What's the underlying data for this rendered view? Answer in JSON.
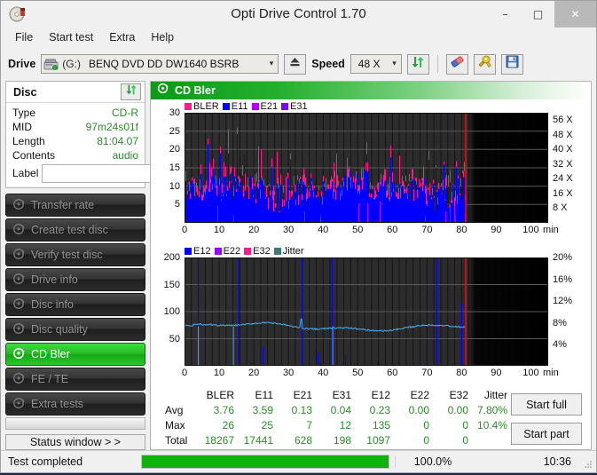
{
  "window": {
    "title": "Opti Drive Control 1.70",
    "icon": "disc-icon",
    "minimize": "–",
    "maximize": "□",
    "close": "✕"
  },
  "menu": {
    "items": [
      "File",
      "Start test",
      "Extra",
      "Help"
    ]
  },
  "toolbar": {
    "drive_label": "Drive",
    "drive_letter": "(G:)",
    "drive_value": "BENQ DVD DD DW1640 BSRB",
    "eject_icon": "eject-icon",
    "speed_label": "Speed",
    "speed_value": "48 X",
    "refresh_icon": "refresh-icon",
    "erase_icon": "eraser-icon",
    "tools_icon": "tools-icon",
    "save_icon": "floppy-save-icon"
  },
  "disc": {
    "header": "Disc",
    "refresh_icon": "refresh-icon",
    "rows": [
      {
        "key": "Type",
        "value": "CD-R"
      },
      {
        "key": "MID",
        "value": "97m24s01f"
      },
      {
        "key": "Length",
        "value": "81:04.07"
      },
      {
        "key": "Contents",
        "value": "audio"
      }
    ],
    "label_key": "Label",
    "label_value": "",
    "label_placeholder": "",
    "disc_icon": "cd-disc-icon"
  },
  "nav": {
    "items": [
      {
        "label": "Transfer rate",
        "icon": "disc-icon",
        "active": false
      },
      {
        "label": "Create test disc",
        "icon": "disc-icon",
        "active": false
      },
      {
        "label": "Verify test disc",
        "icon": "disc-icon",
        "active": false
      },
      {
        "label": "Drive info",
        "icon": "disc-icon",
        "active": false
      },
      {
        "label": "Disc info",
        "icon": "disc-icon",
        "active": false
      },
      {
        "label": "Disc quality",
        "icon": "disc-icon",
        "active": false
      },
      {
        "label": "CD Bler",
        "icon": "disc-icon",
        "active": true
      },
      {
        "label": "FE / TE",
        "icon": "disc-icon",
        "active": false
      },
      {
        "label": "Extra tests",
        "icon": "disc-icon",
        "active": false
      }
    ],
    "status_window": "Status window > >"
  },
  "panel": {
    "title": "CD Bler",
    "icon": "disc-icon"
  },
  "chart_data": [
    {
      "id": "top",
      "type": "bar",
      "title": "",
      "xlabel": "min",
      "ylabel": "",
      "xlim": [
        0,
        105
      ],
      "ylim": [
        0,
        30
      ],
      "xticks": [
        0,
        10,
        20,
        30,
        40,
        50,
        60,
        70,
        80,
        90,
        100
      ],
      "xticklabels": [
        "0",
        "10",
        "20",
        "30",
        "40",
        "50",
        "60",
        "70",
        "80",
        "90",
        "100"
      ],
      "yticks": [
        5,
        10,
        15,
        20,
        25,
        30
      ],
      "yticklabels": [
        "5",
        "10",
        "15",
        "20",
        "25",
        "30"
      ],
      "y2ticks": [
        8,
        16,
        24,
        32,
        40,
        48,
        56
      ],
      "y2ticklabels": [
        "8 X",
        "16 X",
        "24 X",
        "32 X",
        "40 X",
        "48 X",
        "56 X"
      ],
      "y2lim": [
        0,
        60
      ],
      "grid": true,
      "data_end_min": 81.2,
      "legend": [
        {
          "name": "BLER",
          "color": "#ff1a8c"
        },
        {
          "name": "E11",
          "color": "#0000ff"
        },
        {
          "name": "E21",
          "color": "#b400ff"
        },
        {
          "name": "E31",
          "color": "#8000ff"
        }
      ],
      "series": [
        {
          "name": "BLER",
          "color": "#ff1a8c",
          "avg": 3.76,
          "max": 26,
          "total": 18267
        },
        {
          "name": "E11",
          "color": "#0000ff",
          "avg": 3.59,
          "max": 25,
          "total": 17441
        },
        {
          "name": "E21",
          "color": "#b400ff",
          "avg": 0.13,
          "max": 7,
          "total": 628
        },
        {
          "name": "E31",
          "color": "#8000ff",
          "avg": 0.04,
          "max": 12,
          "total": 198
        }
      ],
      "speed_marker_min": 81.2,
      "speed_marker_color": "#ff0000"
    },
    {
      "id": "bottom",
      "type": "line",
      "title": "",
      "xlabel": "min",
      "ylabel": "",
      "xlim": [
        0,
        105
      ],
      "ylim": [
        0,
        200
      ],
      "xticks": [
        0,
        10,
        20,
        30,
        40,
        50,
        60,
        70,
        80,
        90,
        100
      ],
      "xticklabels": [
        "0",
        "10",
        "20",
        "30",
        "40",
        "50",
        "60",
        "70",
        "80",
        "90",
        "100"
      ],
      "yticks": [
        50,
        100,
        150,
        200
      ],
      "yticklabels": [
        "50",
        "100",
        "150",
        "200"
      ],
      "y2ticks": [
        4,
        8,
        12,
        16,
        20
      ],
      "y2ticklabels": [
        "4%",
        "8%",
        "12%",
        "16%",
        "20%"
      ],
      "y2lim": [
        0,
        20
      ],
      "grid": true,
      "data_end_min": 81.2,
      "legend": [
        {
          "name": "E12",
          "color": "#0000ff"
        },
        {
          "name": "E22",
          "color": "#9900ff"
        },
        {
          "name": "E32",
          "color": "#ff1a8c"
        },
        {
          "name": "Jitter",
          "color": "#3d7b7b"
        }
      ],
      "series": [
        {
          "name": "E12",
          "color": "#0000ff",
          "avg": 0.23,
          "max": 135,
          "total": 1097
        },
        {
          "name": "E22",
          "color": "#9900ff",
          "avg": 0.0,
          "max": 0,
          "total": 0
        },
        {
          "name": "E32",
          "color": "#ff1a8c",
          "avg": 0.0,
          "max": 0,
          "total": 0
        },
        {
          "name": "Jitter",
          "color": "#4aa3e0",
          "avg_pct": "7.80%",
          "max_pct": "10.4%"
        }
      ],
      "jitter_trace_color": "#4aa3e0",
      "jitter_avg_percent": 7.8,
      "speed_marker_min": 81.2,
      "speed_marker_color": "#ff0000"
    }
  ],
  "stats": {
    "columns": [
      "BLER",
      "E11",
      "E21",
      "E31",
      "E12",
      "E22",
      "E32",
      "Jitter"
    ],
    "rows": [
      {
        "label": "Avg",
        "values": [
          "3.76",
          "3.59",
          "0.13",
          "0.04",
          "0.23",
          "0.00",
          "0.00",
          "7.80%"
        ]
      },
      {
        "label": "Max",
        "values": [
          "26",
          "25",
          "7",
          "12",
          "135",
          "0",
          "0",
          "10.4%"
        ]
      },
      {
        "label": "Total",
        "values": [
          "18267",
          "17441",
          "628",
          "198",
          "1097",
          "0",
          "0",
          ""
        ]
      }
    ]
  },
  "actions": {
    "start_full": "Start full",
    "start_part": "Start part"
  },
  "statusbar": {
    "text": "Test completed",
    "percent_label": "100.0%",
    "percent_value": 100,
    "time": "10:36",
    "bar_color": "#12b012"
  }
}
